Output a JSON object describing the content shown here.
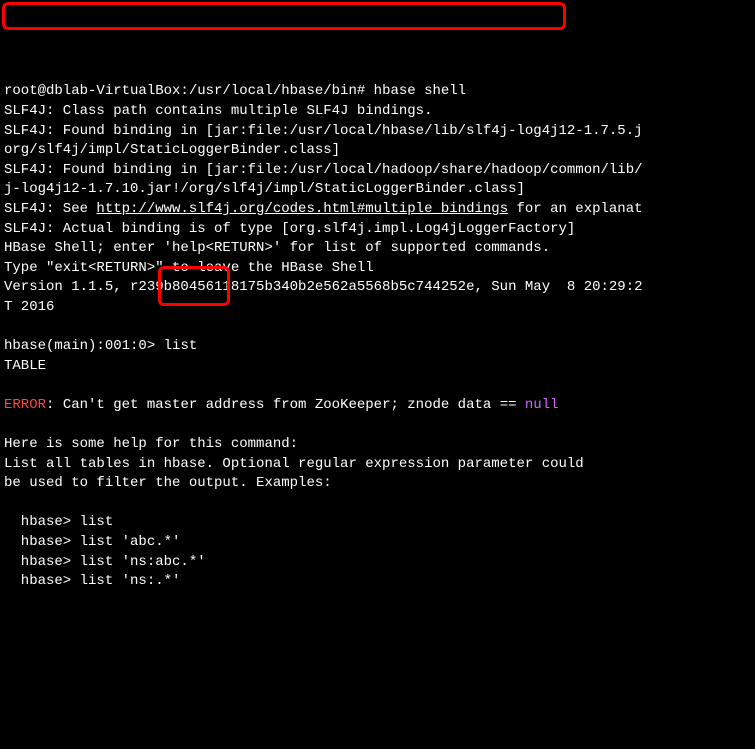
{
  "prompt1_path": "root@dblab-VirtualBox:/usr/local/hbase/bin#",
  "prompt1_cmd": " hbase shell",
  "slf4j_line1": "SLF4J: Class path contains multiple SLF4J bindings.",
  "slf4j_line2": "SLF4J: Found binding in [jar:file:/usr/local/hbase/lib/slf4j-log4j12-1.7.5.j",
  "slf4j_line3": "org/slf4j/impl/StaticLoggerBinder.class]",
  "slf4j_line4": "SLF4J: Found binding in [jar:file:/usr/local/hadoop/share/hadoop/common/lib/",
  "slf4j_line5": "j-log4j12-1.7.10.jar!/org/slf4j/impl/StaticLoggerBinder.class]",
  "slf4j_see_pre": "SLF4J: See ",
  "slf4j_see_url": "http://www.slf4j.org/codes.html#multiple_bindings",
  "slf4j_see_post": " for an explanat",
  "slf4j_line7": "SLF4J: Actual binding is of type [org.slf4j.impl.Log4jLoggerFactory]",
  "hbase_help": "HBase Shell; enter 'help<RETURN>' for list of supported commands.",
  "hbase_exit": "Type \"exit<RETURN>\" to leave the HBase Shell",
  "version": "Version 1.1.5, r239b80456118175b340b2e562a5568b5c744252e, Sun May  8 20:29:2",
  "version_tail": "T 2016",
  "prompt2_pre": "hbase(main):001:0>",
  "prompt2_cmd": " list",
  "table_header": "TABLE",
  "error_label": "ERROR",
  "error_msg": ": Can't get master address from ZooKeeper; znode data == ",
  "null_word": "null",
  "help_intro": "Here is some help for this command:",
  "help_line1": "List all tables in hbase. Optional regular expression parameter could",
  "help_line2": "be used to filter the output. Examples:",
  "example1": "  hbase> list",
  "example2": "  hbase> list 'abc.*'",
  "example3": "  hbase> list 'ns:abc.*'",
  "example4": "  hbase> list 'ns:.*'"
}
